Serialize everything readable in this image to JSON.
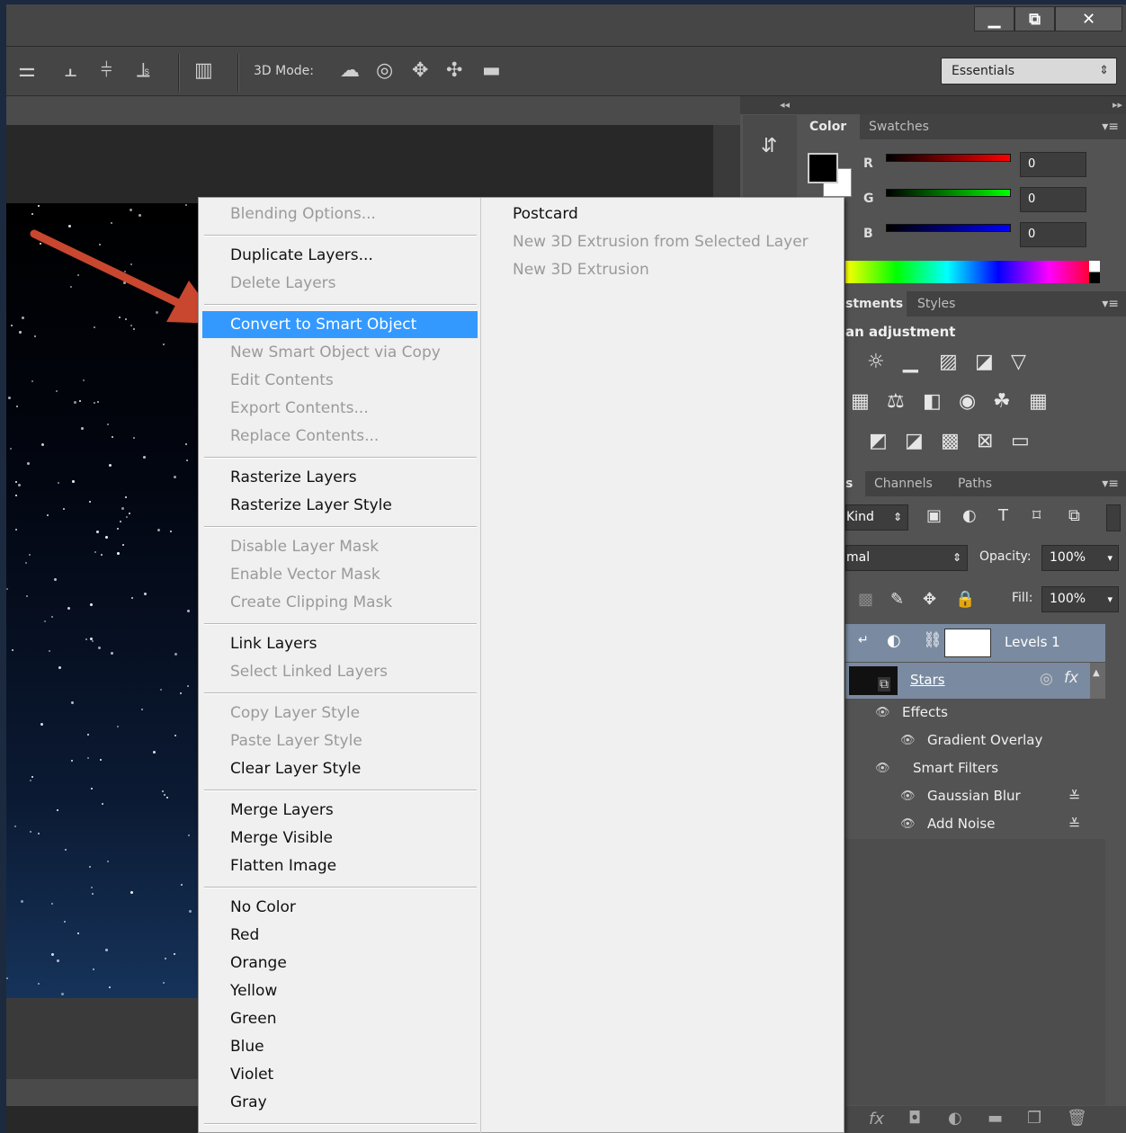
{
  "window": {
    "minimize": "▁",
    "restore": "⧉",
    "close": "✕"
  },
  "options_bar": {
    "mode_label": "3D Mode:",
    "workspace": "Essentials"
  },
  "context_menu": {
    "items": [
      {
        "label": "Blending Options...",
        "enabled": false
      },
      {
        "label": "Duplicate Layers...",
        "enabled": true
      },
      {
        "label": "Delete Layers",
        "enabled": false
      },
      {
        "label": "Convert to Smart Object",
        "enabled": true,
        "highlighted": true
      },
      {
        "label": "New Smart Object via Copy",
        "enabled": false
      },
      {
        "label": "Edit Contents",
        "enabled": false
      },
      {
        "label": "Export Contents...",
        "enabled": false
      },
      {
        "label": "Replace Contents...",
        "enabled": false
      },
      {
        "label": "Rasterize Layers",
        "enabled": true
      },
      {
        "label": "Rasterize Layer Style",
        "enabled": true
      },
      {
        "label": "Disable Layer Mask",
        "enabled": false
      },
      {
        "label": "Enable Vector Mask",
        "enabled": false
      },
      {
        "label": "Create Clipping Mask",
        "enabled": false
      },
      {
        "label": "Link Layers",
        "enabled": true
      },
      {
        "label": "Select Linked Layers",
        "enabled": false
      },
      {
        "label": "Copy Layer Style",
        "enabled": false
      },
      {
        "label": "Paste Layer Style",
        "enabled": false
      },
      {
        "label": "Clear Layer Style",
        "enabled": true
      },
      {
        "label": "Merge Layers",
        "enabled": true
      },
      {
        "label": "Merge Visible",
        "enabled": true
      },
      {
        "label": "Flatten Image",
        "enabled": true
      },
      {
        "label": "No Color",
        "enabled": true
      },
      {
        "label": "Red",
        "enabled": true
      },
      {
        "label": "Orange",
        "enabled": true
      },
      {
        "label": "Yellow",
        "enabled": true
      },
      {
        "label": "Green",
        "enabled": true
      },
      {
        "label": "Blue",
        "enabled": true
      },
      {
        "label": "Violet",
        "enabled": true
      },
      {
        "label": "Gray",
        "enabled": true
      }
    ],
    "sub_items": [
      {
        "label": "Postcard",
        "enabled": true
      },
      {
        "label": "New 3D Extrusion from Selected Layer",
        "enabled": false
      },
      {
        "label": "New 3D Extrusion",
        "enabled": false
      }
    ],
    "highlight_color": "#3399ff"
  },
  "color_panel": {
    "tabs": [
      "Color",
      "Swatches"
    ],
    "r_label": "R",
    "g_label": "G",
    "b_label": "B",
    "r": "0",
    "g": "0",
    "b": "0",
    "foreground": "#000000",
    "background": "#ffffff"
  },
  "adjustments_panel": {
    "tabs": [
      "stments",
      "Styles"
    ],
    "heading": "an adjustment"
  },
  "layers_panel": {
    "tabs": [
      "s",
      "Channels",
      "Paths"
    ],
    "filter_kind": "Kind",
    "blend_mode": "mal",
    "opacity_label": "Opacity:",
    "opacity": "100%",
    "fill_label": "Fill:",
    "fill": "100%",
    "layers": [
      {
        "name": "Levels 1"
      },
      {
        "name": "Stars"
      }
    ],
    "effects_label": "Effects",
    "gradient_overlay": "Gradient Overlay",
    "smart_filters": "Smart Filters",
    "gaussian_blur": "Gaussian Blur",
    "add_noise": "Add Noise"
  }
}
